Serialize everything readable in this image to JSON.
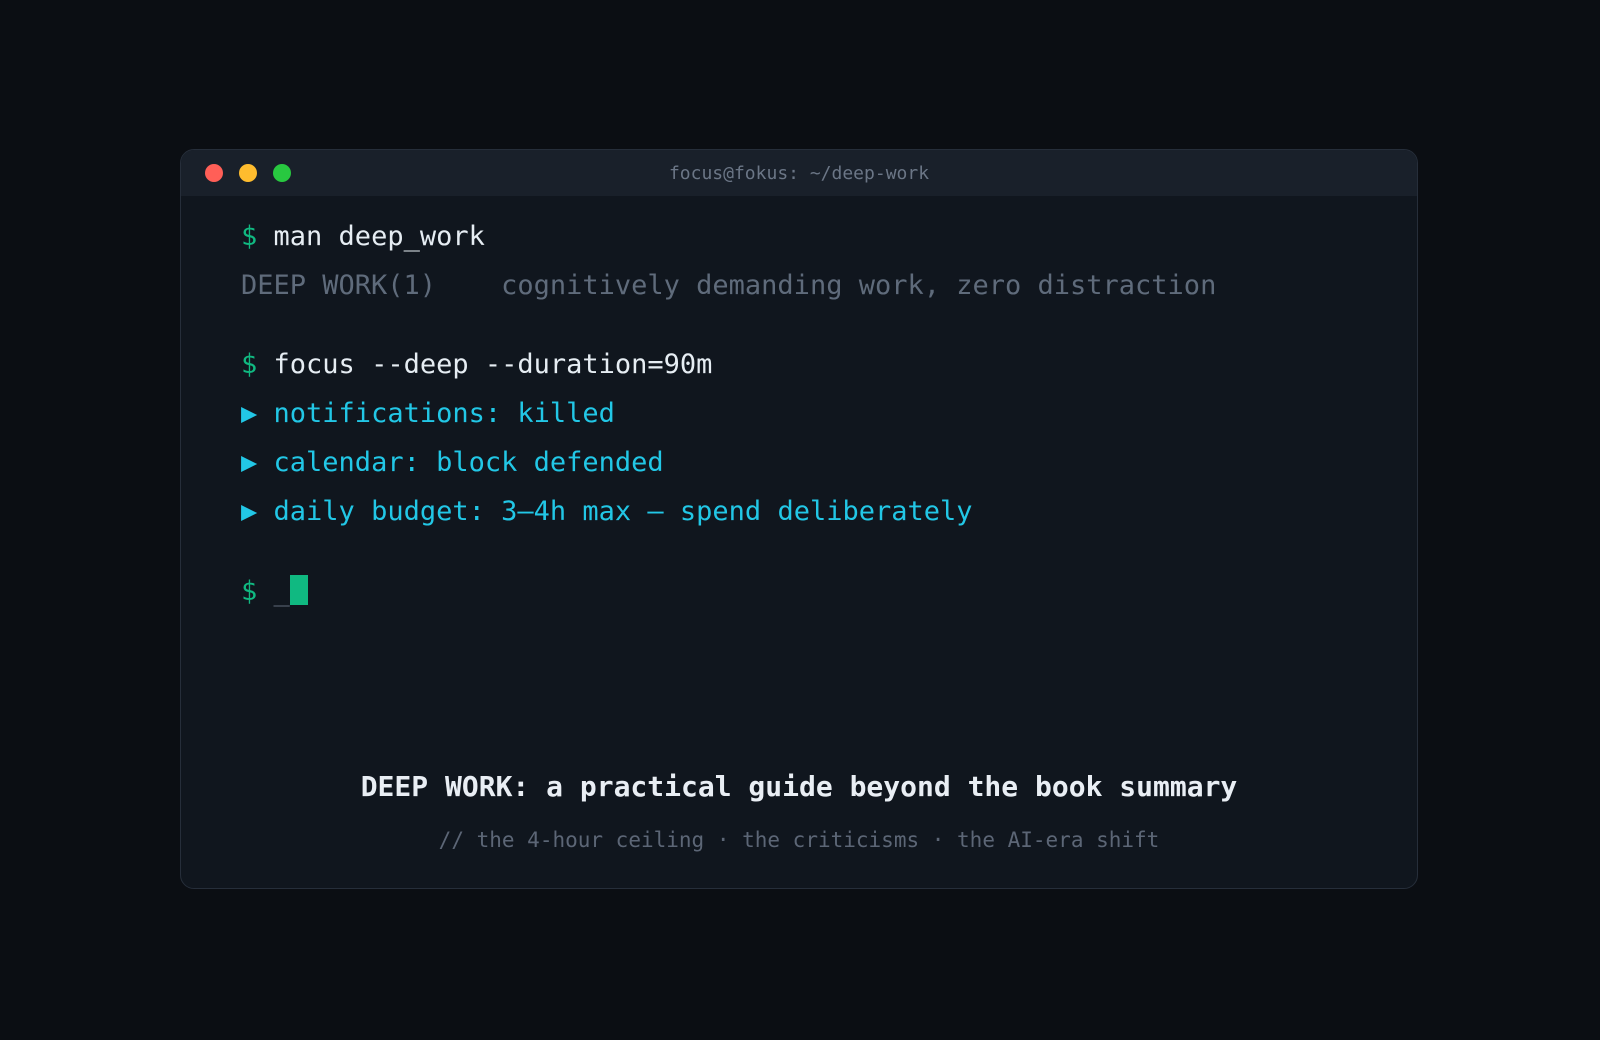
{
  "window": {
    "title": "focus@fokus: ~/deep-work",
    "traffic_lights": {
      "close": "#ff5f57",
      "minimize": "#febc2e",
      "maximize": "#28c840"
    }
  },
  "terminal": {
    "prompt": "$",
    "bullet": "▶",
    "command_1": "man deep_work",
    "man_header": "DEEP WORK(1)    cognitively demanding work, zero distraction",
    "command_2": "focus --deep --duration=90m",
    "output": [
      "notifications: killed",
      "calendar: block defended",
      "daily budget: 3–4h max — spend deliberately"
    ],
    "input_value": "_"
  },
  "footer": {
    "headline": "DEEP WORK: a practical guide beyond the book summary",
    "subline": "// the 4-hour ceiling · the criticisms · the AI-era shift"
  },
  "colors": {
    "background": "#0b0e13",
    "window_bg": "#10161e",
    "titlebar_bg": "#19202a",
    "prompt": "#10b981",
    "output": "#22c7e6",
    "dim_text": "#5f6b7b"
  }
}
